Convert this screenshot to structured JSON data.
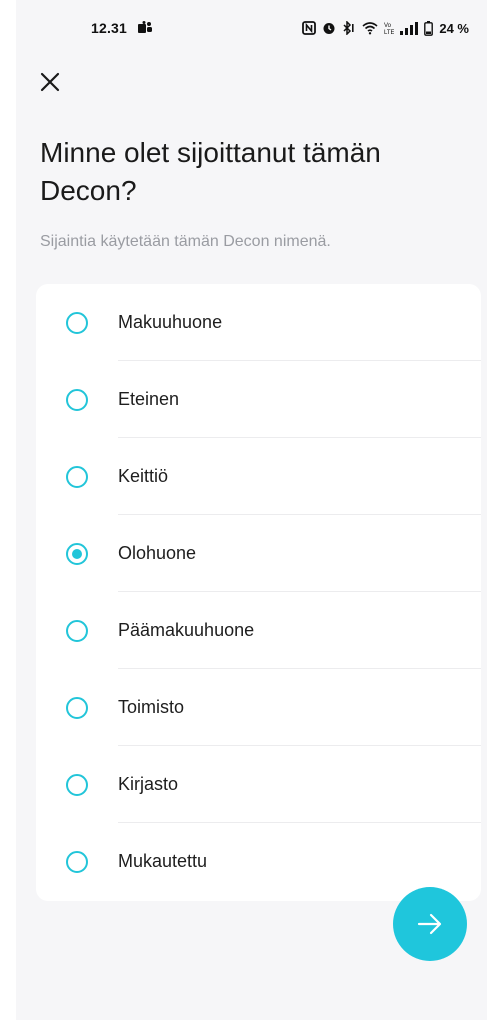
{
  "status_bar": {
    "time": "12.31",
    "battery": "24 %",
    "icons": [
      "teams-icon",
      "nfc-icon",
      "alarm-icon",
      "bluetooth-icon",
      "wifi-icon",
      "volte-icon",
      "signal-icon",
      "battery-icon"
    ]
  },
  "header": {
    "close_icon": "close-icon"
  },
  "title": "Minne olet sijoittanut tämän Decon?",
  "subtitle": "Sijaintia käytetään tämän Decon nimenä.",
  "options": [
    {
      "label": "Makuuhuone",
      "selected": false
    },
    {
      "label": "Eteinen",
      "selected": false
    },
    {
      "label": "Keittiö",
      "selected": false
    },
    {
      "label": "Olohuone",
      "selected": true
    },
    {
      "label": "Päämakuuhuone",
      "selected": false
    },
    {
      "label": "Toimisto",
      "selected": false
    },
    {
      "label": "Kirjasto",
      "selected": false
    },
    {
      "label": "Mukautettu",
      "selected": false
    }
  ],
  "next_button": {
    "icon": "arrow-right-icon"
  },
  "colors": {
    "accent": "#1fc6dc",
    "background": "#f6f6f8",
    "card": "#ffffff",
    "subtitle": "#9a9ca2"
  }
}
